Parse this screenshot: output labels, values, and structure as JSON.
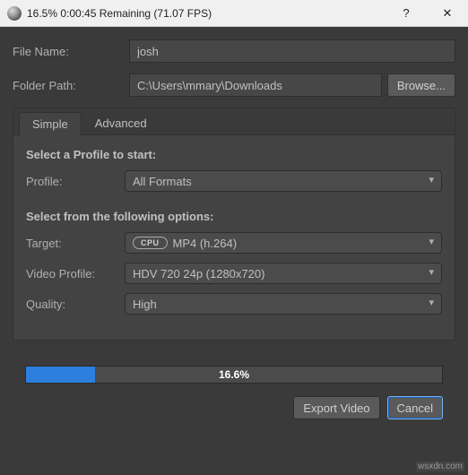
{
  "titlebar": {
    "title": "16.5%  0:00:45 Remaining (71.07 FPS)",
    "help_label": "?",
    "close_label": "✕"
  },
  "fields": {
    "filename_label": "File Name:",
    "filename_value": "josh",
    "folder_label": "Folder Path:",
    "folder_value": "C:\\Users\\mmary\\Downloads",
    "browse_label": "Browse..."
  },
  "tabs": {
    "simple": "Simple",
    "advanced": "Advanced"
  },
  "profile_section": {
    "heading": "Select a Profile to start:",
    "profile_label": "Profile:",
    "profile_value": "All Formats"
  },
  "options_section": {
    "heading": "Select from the following options:",
    "target_label": "Target:",
    "target_badge": "CPU",
    "target_value": "MP4 (h.264)",
    "video_profile_label": "Video Profile:",
    "video_profile_value": "HDV 720 24p (1280x720)",
    "quality_label": "Quality:",
    "quality_value": "High"
  },
  "progress": {
    "percent_text": "16.6%",
    "percent_value": 16.6
  },
  "footer": {
    "export_label": "Export Video",
    "cancel_label": "Cancel"
  },
  "watermark": "wsxdn.com",
  "colors": {
    "progress_fill": "#2d7fdd",
    "background": "#3a3a3a"
  }
}
